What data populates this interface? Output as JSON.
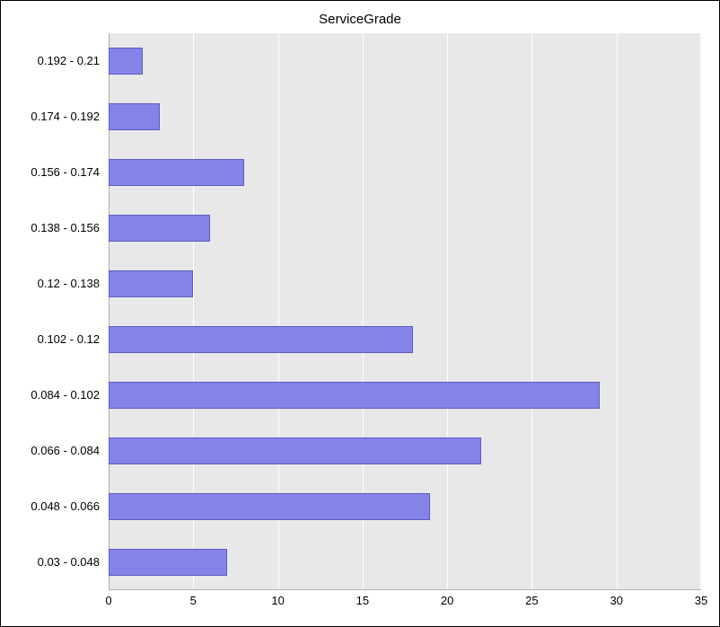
{
  "chart_data": {
    "type": "bar",
    "orientation": "horizontal",
    "title": "ServiceGrade",
    "xlabel": "",
    "ylabel": "",
    "xlim": [
      0,
      35
    ],
    "x_ticks": [
      0,
      5,
      10,
      15,
      20,
      25,
      30,
      35
    ],
    "categories": [
      "0.03 - 0.048",
      "0.048 - 0.066",
      "0.066 - 0.084",
      "0.084 - 0.102",
      "0.102 - 0.12",
      "0.12 - 0.138",
      "0.138 - 0.156",
      "0.156 - 0.174",
      "0.174 - 0.192",
      "0.192 - 0.21"
    ],
    "values": [
      7,
      19,
      22,
      29,
      18,
      5,
      6,
      8,
      3,
      2
    ],
    "colors": {
      "bar_fill": "#8484e8",
      "bar_border": "#5c5cc0",
      "plot_bg": "#e8e8e8",
      "grid": "#ffffff"
    }
  }
}
